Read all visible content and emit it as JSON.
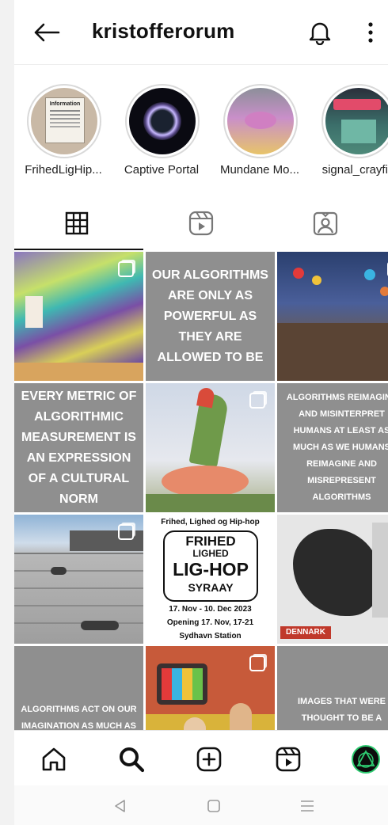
{
  "header": {
    "title": "kristofferorum",
    "back_icon": "arrow-left-icon",
    "bell_icon": "bell-icon",
    "more_icon": "more-vertical-icon"
  },
  "highlights": [
    {
      "label": "FrihedLigHip..."
    },
    {
      "label": "Captive Portal"
    },
    {
      "label": "Mundane Mo..."
    },
    {
      "label": "signal_crayfis"
    }
  ],
  "highlight_texts": {
    "first_title": "Information"
  },
  "tabs": [
    {
      "icon": "grid-icon",
      "active": true
    },
    {
      "icon": "reels-icon",
      "active": false
    },
    {
      "icon": "tagged-icon",
      "active": false
    }
  ],
  "posts": {
    "p2": "OUR ALGORITHMS ARE ONLY AS POWERFUL AS THEY ARE ALLOWED TO BE",
    "p4": "EVERY METRIC OF ALGORITHMIC MEASUREMENT IS AN EXPRESSION OF A CULTURAL NORM",
    "p6": "ALGORITHMS REIMAGINE AND MISINTERPRET HUMANS AT LEAST AS MUCH AS WE HUMANS REIMAGINE AND MISREPRESENT ALGORITHMS",
    "p8_title": "Frihed, Lighed og Hip-hop",
    "p8_logo1": "FRIHED",
    "p8_logo2": "LIGHED",
    "p8_logo3": "LIG-HOP",
    "p8_logo4": "SYRAAY",
    "p8_line1": "17. Nov - 10. Dec 2023",
    "p8_line2": "Opening 17. Nov, 17-21",
    "p8_line3": "Sydhavn Station",
    "p9_label": "DENNARK",
    "p10": "ALGORITHMS ACT ON OUR IMAGINATION AS MUCH AS THEY ACT ON OUR",
    "p12": "IMAGES THAT WERE THOUGHT TO BE A REPRESENTATION OF LIV LIVES HAVE NOW BECO"
  },
  "bottom_nav": [
    {
      "icon": "home-icon"
    },
    {
      "icon": "search-icon"
    },
    {
      "icon": "plus-square-icon"
    },
    {
      "icon": "reels-icon"
    },
    {
      "icon": "profile-avatar"
    }
  ],
  "system_nav": [
    {
      "icon": "back-triangle-icon"
    },
    {
      "icon": "home-square-icon"
    },
    {
      "icon": "menu-lines-icon"
    }
  ],
  "colors": {
    "text_tile": "#8f8f8f",
    "accent": "#111111"
  }
}
